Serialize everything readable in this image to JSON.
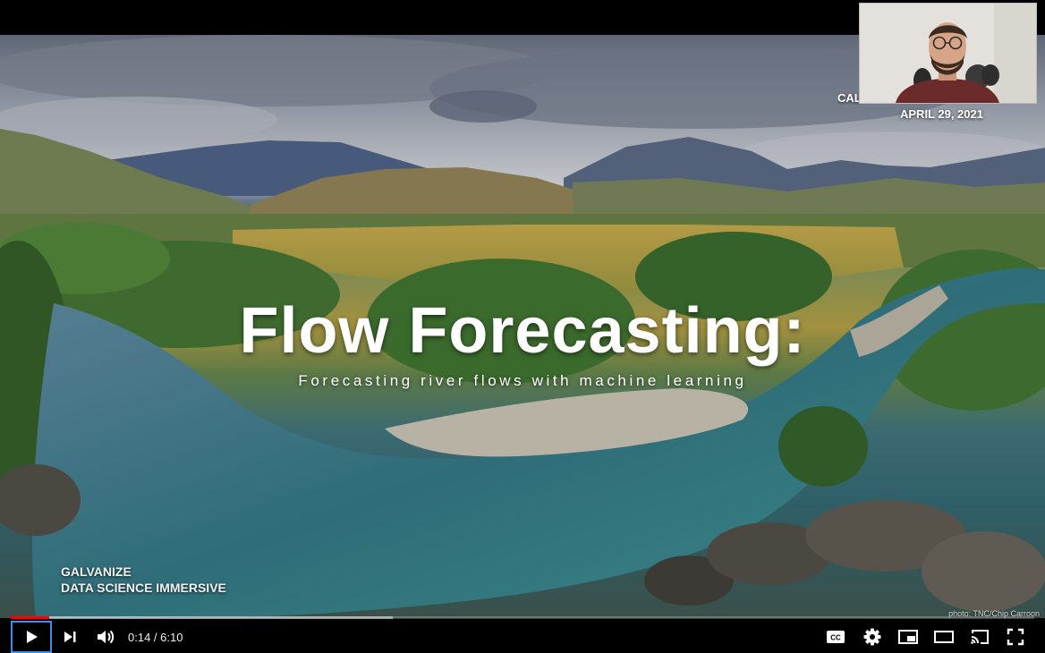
{
  "slide": {
    "title": "Flow Forecasting:",
    "subtitle": "Forecasting river flows with machine learning",
    "org_line1": "GALVANIZE",
    "org_line2": "DATA SCIENCE IMMERSIVE",
    "partial_label": "CALE",
    "date": "APRIL 29, 2021",
    "photo_credit": "photo: TNC/Chip Carroon"
  },
  "player": {
    "time_display": "0:14 / 6:10",
    "progress_played_fraction": 0.0378,
    "progress_buffered_fraction": 0.373,
    "icons": {
      "play": "play-icon",
      "next": "next-icon",
      "volume": "volume-icon",
      "captions": "captions-icon",
      "settings": "settings-icon",
      "miniplayer": "miniplayer-icon",
      "theater": "theater-icon",
      "cast": "cast-icon",
      "fullscreen": "fullscreen-icon"
    },
    "accent_color": "#ff0000",
    "focus_color": "#3a8ee6"
  }
}
